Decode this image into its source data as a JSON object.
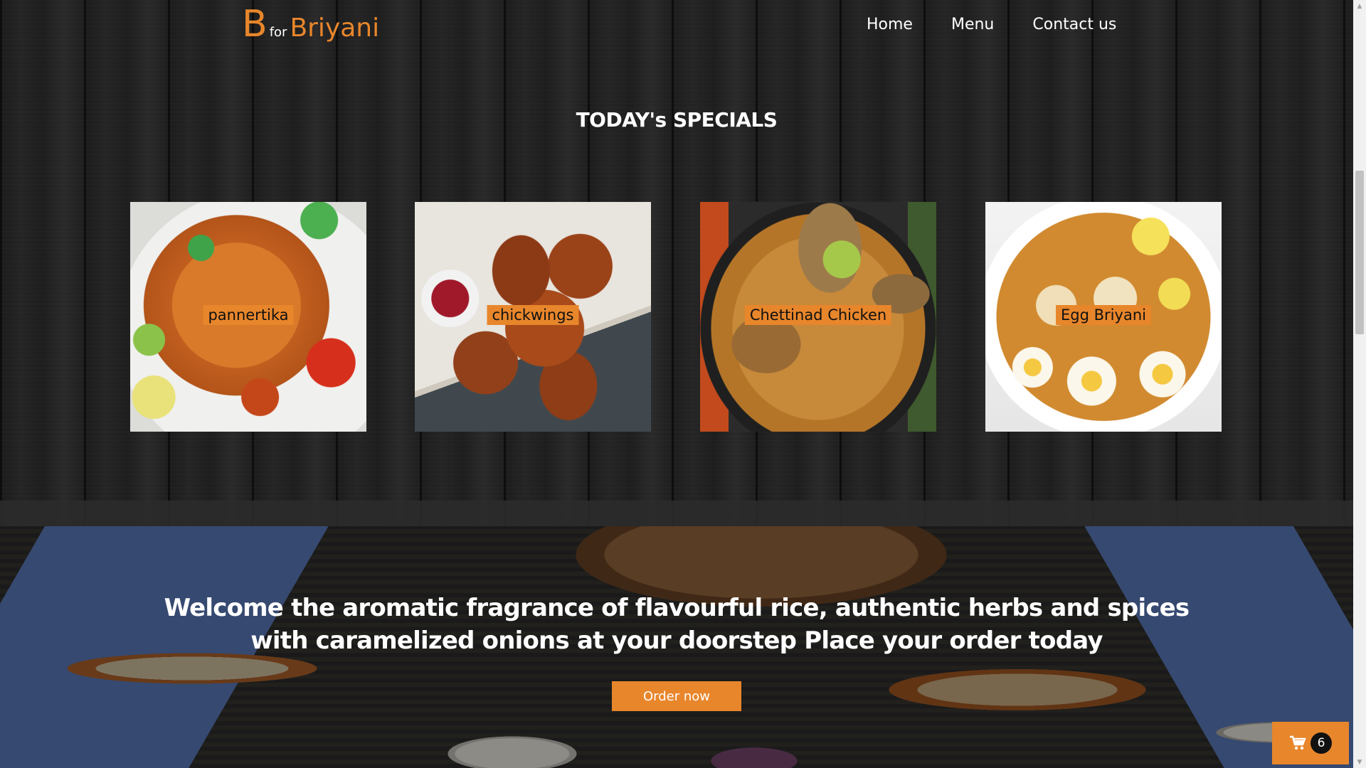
{
  "brand": {
    "big_letter": "B",
    "connector": "for",
    "name": "Briyani",
    "accent_color": "#e8862b"
  },
  "nav": {
    "items": [
      {
        "label": "Home"
      },
      {
        "label": "Menu"
      },
      {
        "label": "Contact us"
      }
    ]
  },
  "specials": {
    "title": "TODAY's SPECIALS",
    "items": [
      {
        "label": "pannertika",
        "image": "paneer-tikka-image"
      },
      {
        "label": "chickwings",
        "image": "chicken-wings-image"
      },
      {
        "label": "Chettinad Chicken",
        "image": "chettinad-chicken-image"
      },
      {
        "label": "Egg Briyani",
        "image": "egg-briyani-image"
      }
    ]
  },
  "hero": {
    "message": "Welcome the aromatic fragrance of flavourful rice, authentic herbs and spices with caramelized onions at your doorstep Place your order today",
    "cta_label": "Order now"
  },
  "cart": {
    "icon": "cart-icon",
    "count": "6"
  }
}
